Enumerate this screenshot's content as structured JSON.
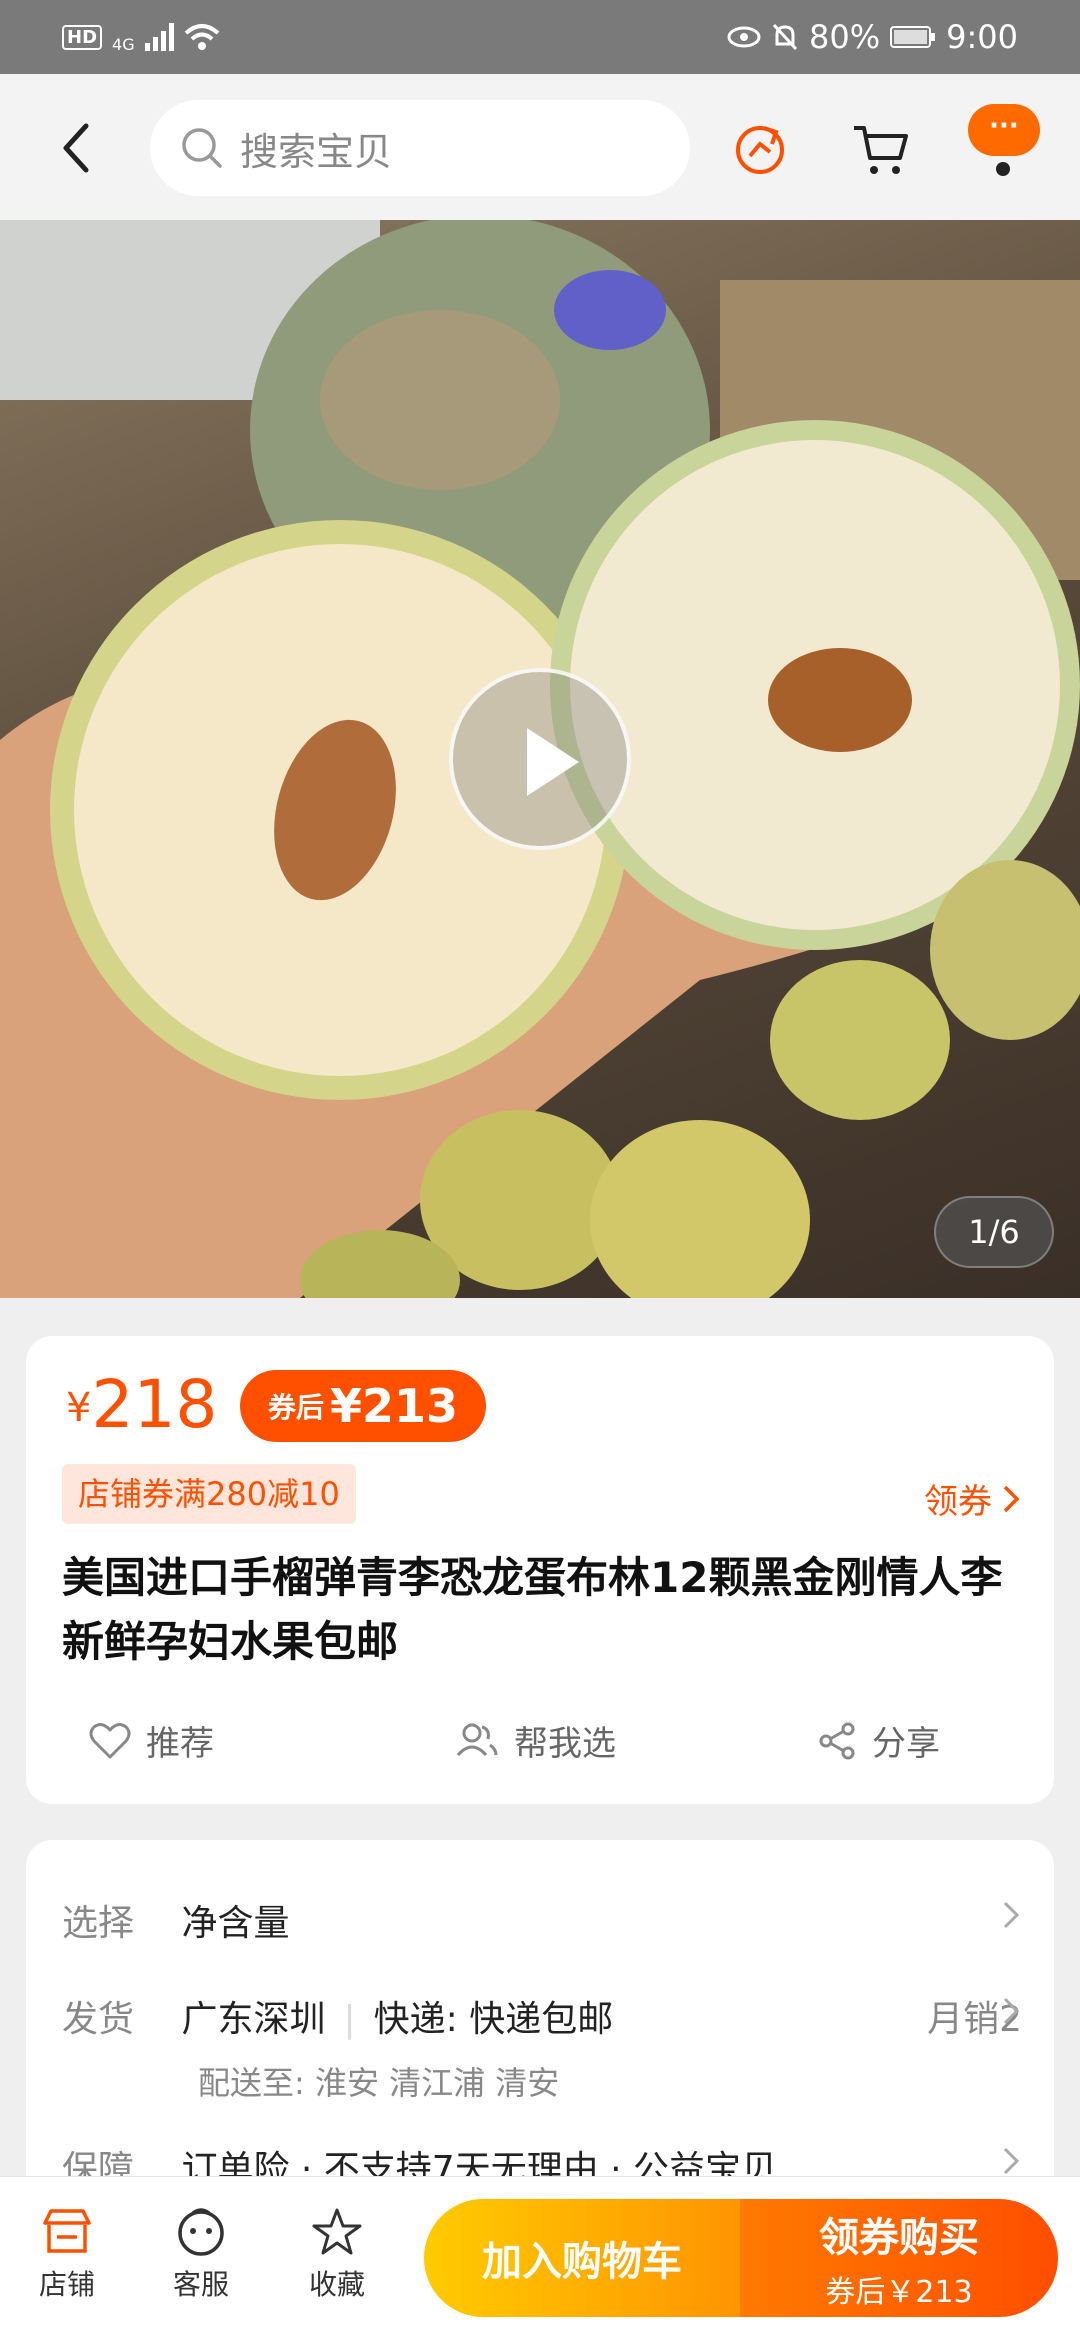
{
  "status_bar": {
    "network": "4G",
    "battery": "80%",
    "time": "9:00"
  },
  "search": {
    "placeholder": "搜索宝贝"
  },
  "header": {
    "more_label": "···"
  },
  "gallery": {
    "counter": "1/6"
  },
  "product": {
    "price_symbol": "¥",
    "price": "218",
    "coupon_label": "券后",
    "coupon_price": "¥213",
    "shop_coupon": "店铺券满280减10",
    "get_coupon": "领券",
    "title": "美国进口手榴弹青李恐龙蛋布林12颗黑金刚情人李新鲜孕妇水果包邮",
    "actions": {
      "recommend": "推荐",
      "help_choose": "帮我选",
      "share": "分享"
    }
  },
  "specs": {
    "select_key": "选择",
    "select_value": "净含量",
    "ship_key": "发货",
    "ship_from": "广东深圳",
    "express": "快递: 快递包邮",
    "monthly_sales": "月销2",
    "deliver_to": "配送至: 淮安 清江浦 清安",
    "guarantee_key": "保障",
    "guarantee_value": "订单险 · 不支持7天无理由 · 公益宝贝"
  },
  "bottom_bar": {
    "shop": "店铺",
    "service": "客服",
    "favorite": "收藏",
    "add_to_cart": "加入购物车",
    "buy_with_coupon": "领券购买",
    "buy_price": "券后￥213"
  },
  "colors": {
    "accent": "#ff5000",
    "cart_gradient": "#ffcb00",
    "buy_gradient": "#ff4e00"
  }
}
